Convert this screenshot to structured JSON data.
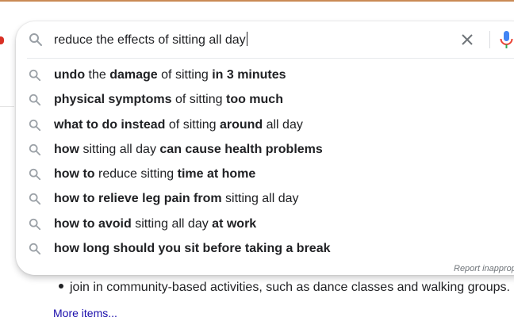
{
  "search": {
    "query": "reduce the effects of sitting all day",
    "clear_label": "×"
  },
  "suggestions": [
    [
      {
        "t": "undo",
        "b": true
      },
      {
        "t": " the ",
        "b": false
      },
      {
        "t": "damage",
        "b": true
      },
      {
        "t": " of sitting ",
        "b": false
      },
      {
        "t": "in 3 minutes",
        "b": true
      }
    ],
    [
      {
        "t": "physical symptoms",
        "b": true
      },
      {
        "t": " of sitting ",
        "b": false
      },
      {
        "t": "too much",
        "b": true
      }
    ],
    [
      {
        "t": "what to do instead",
        "b": true
      },
      {
        "t": " of sitting ",
        "b": false
      },
      {
        "t": "around",
        "b": true
      },
      {
        "t": " all day",
        "b": false
      }
    ],
    [
      {
        "t": "how",
        "b": true
      },
      {
        "t": " sitting all day ",
        "b": false
      },
      {
        "t": "can cause health problems",
        "b": true
      }
    ],
    [
      {
        "t": "how to",
        "b": true
      },
      {
        "t": " reduce sitting ",
        "b": false
      },
      {
        "t": "time at home",
        "b": true
      }
    ],
    [
      {
        "t": "how to relieve leg pain from",
        "b": true
      },
      {
        "t": " sitting all day",
        "b": false
      }
    ],
    [
      {
        "t": "how to avoid",
        "b": true
      },
      {
        "t": " sitting all day ",
        "b": false
      },
      {
        "t": "at work",
        "b": true
      }
    ],
    [
      {
        "t": "how long should you sit before taking a break",
        "b": true
      }
    ]
  ],
  "report_label": "Report inapprop",
  "page": {
    "bullet_text": "join in community-based activities, such as dance classes and walking groups.",
    "more_link": "More items..."
  },
  "colors": {
    "link": "#1a0dab",
    "icon_gray": "#9aa0a6",
    "mic_blue": "#4285f4",
    "mic_red": "#ea4335"
  },
  "icons": {
    "search": "search-icon",
    "clear": "close-icon",
    "mic": "microphone-icon"
  }
}
